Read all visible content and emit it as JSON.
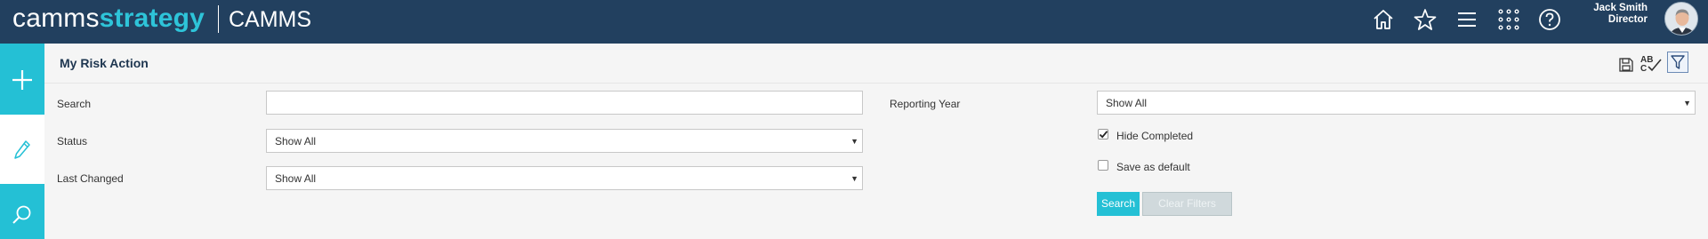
{
  "brand": {
    "logo_light": "camms",
    "logo_bold": "strategy",
    "app_name": "CAMMS"
  },
  "topnav": {
    "icons": [
      "home-icon",
      "star-icon",
      "menu-icon",
      "apps-grid-icon",
      "help-icon"
    ]
  },
  "user": {
    "name": "Jack Smith",
    "role": "Director"
  },
  "rail": {
    "items": [
      "add-icon",
      "edit-pencil-icon",
      "search-icon"
    ]
  },
  "page": {
    "title": "My Risk Action"
  },
  "toolbar": {
    "icons": [
      "save-icon",
      "spellcheck-icon",
      "filter-icon"
    ]
  },
  "filters": {
    "search": {
      "label": "Search",
      "value": ""
    },
    "status": {
      "label": "Status",
      "value": "Show All"
    },
    "last_changed": {
      "label": "Last Changed",
      "value": "Show All"
    },
    "reporting_year": {
      "label": "Reporting Year",
      "value": "Show All"
    },
    "hide_completed": {
      "label": "Hide Completed",
      "checked": true
    },
    "save_default": {
      "label": "Save as default",
      "checked": false
    }
  },
  "buttons": {
    "search": "Search",
    "clear": "Clear Filters"
  },
  "colors": {
    "topbar": "#22405f",
    "accent": "#24c0d5",
    "title": "#1e3650"
  }
}
